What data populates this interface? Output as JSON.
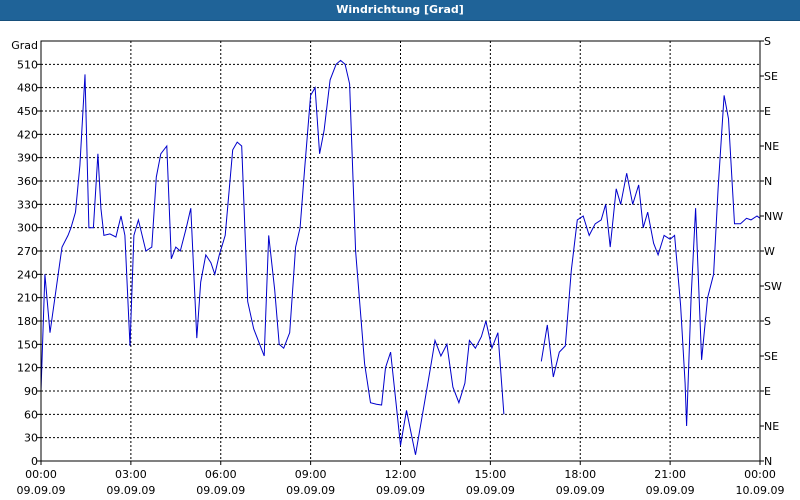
{
  "window": {
    "title": "Windrichtung [Grad]"
  },
  "chart_data": {
    "type": "line",
    "title": "Windrichtung [Grad]",
    "ylabel": "Grad",
    "xlabel": "",
    "ylim": [
      0,
      540
    ],
    "yticks": [
      0,
      30,
      60,
      90,
      120,
      150,
      180,
      210,
      240,
      270,
      300,
      330,
      360,
      390,
      420,
      450,
      480,
      510
    ],
    "right_axis": {
      "labels": [
        "N",
        "NE",
        "E",
        "SE",
        "S",
        "SW",
        "W",
        "NW",
        "N",
        "NE",
        "E",
        "SE",
        "S"
      ]
    },
    "xlim_hours": [
      0,
      24
    ],
    "xticks": [
      {
        "time": "00:00",
        "date": "09.09.09"
      },
      {
        "time": "03:00",
        "date": "09.09.09"
      },
      {
        "time": "06:00",
        "date": "09.09.09"
      },
      {
        "time": "09:00",
        "date": "09.09.09"
      },
      {
        "time": "12:00",
        "date": "09.09.09"
      },
      {
        "time": "15:00",
        "date": "09.09.09"
      },
      {
        "time": "18:00",
        "date": "09.09.09"
      },
      {
        "time": "21:00",
        "date": "09.09.09"
      },
      {
        "time": "00:00",
        "date": "10.09.09"
      }
    ],
    "grid": true,
    "line_color": "#0000cc",
    "series": [
      {
        "segments": [
          [
            [
              0.0,
              90
            ],
            [
              0.13,
              240
            ],
            [
              0.3,
              165
            ],
            [
              0.5,
              220
            ],
            [
              0.7,
              275
            ],
            [
              0.9,
              290
            ],
            [
              1.0,
              300
            ],
            [
              1.15,
              320
            ],
            [
              1.3,
              380
            ],
            [
              1.47,
              497
            ],
            [
              1.6,
              300
            ],
            [
              1.75,
              300
            ],
            [
              1.9,
              395
            ],
            [
              2.0,
              325
            ],
            [
              2.1,
              290
            ],
            [
              2.3,
              292
            ],
            [
              2.5,
              288
            ],
            [
              2.67,
              315
            ],
            [
              2.8,
              290
            ],
            [
              2.97,
              148
            ],
            [
              3.1,
              290
            ],
            [
              3.25,
              310
            ],
            [
              3.5,
              270
            ],
            [
              3.7,
              275
            ],
            [
              3.85,
              365
            ],
            [
              4.0,
              395
            ],
            [
              4.2,
              405
            ],
            [
              4.35,
              260
            ],
            [
              4.5,
              275
            ],
            [
              4.65,
              270
            ],
            [
              4.85,
              300
            ],
            [
              5.0,
              325
            ],
            [
              5.2,
              158
            ],
            [
              5.33,
              230
            ],
            [
              5.5,
              265
            ],
            [
              5.67,
              255
            ],
            [
              5.8,
              240
            ],
            [
              5.95,
              265
            ],
            [
              6.15,
              290
            ],
            [
              6.4,
              400
            ],
            [
              6.55,
              410
            ],
            [
              6.7,
              405
            ],
            [
              6.9,
              205
            ],
            [
              7.1,
              170
            ],
            [
              7.3,
              150
            ],
            [
              7.45,
              135
            ],
            [
              7.6,
              290
            ],
            [
              7.8,
              220
            ],
            [
              7.95,
              150
            ],
            [
              8.1,
              145
            ],
            [
              8.3,
              165
            ],
            [
              8.5,
              275
            ],
            [
              8.65,
              300
            ],
            [
              8.8,
              375
            ],
            [
              9.0,
              470
            ],
            [
              9.15,
              480
            ],
            [
              9.3,
              395
            ],
            [
              9.45,
              425
            ],
            [
              9.65,
              490
            ],
            [
              9.85,
              510
            ],
            [
              10.0,
              515
            ],
            [
              10.15,
              510
            ],
            [
              10.3,
              485
            ],
            [
              10.5,
              270
            ],
            [
              10.8,
              125
            ],
            [
              11.0,
              75
            ],
            [
              11.2,
              73
            ],
            [
              11.37,
              72
            ],
            [
              11.5,
              120
            ],
            [
              11.67,
              140
            ],
            [
              11.85,
              75
            ],
            [
              12.0,
              20
            ],
            [
              12.2,
              65
            ],
            [
              12.5,
              8
            ],
            [
              12.8,
              75
            ],
            [
              13.0,
              120
            ],
            [
              13.15,
              155
            ],
            [
              13.35,
              135
            ],
            [
              13.55,
              150
            ],
            [
              13.75,
              95
            ],
            [
              13.95,
              75
            ],
            [
              14.15,
              100
            ],
            [
              14.3,
              155
            ],
            [
              14.5,
              145
            ],
            [
              14.7,
              160
            ],
            [
              14.85,
              180
            ],
            [
              15.05,
              145
            ],
            [
              15.25,
              165
            ],
            [
              15.45,
              60
            ]
          ],
          [
            [
              16.7,
              128
            ],
            [
              16.9,
              175
            ],
            [
              17.1,
              108
            ],
            [
              17.3,
              140
            ],
            [
              17.5,
              148
            ],
            [
              17.7,
              245
            ],
            [
              17.9,
              310
            ],
            [
              18.1,
              315
            ],
            [
              18.3,
              290
            ],
            [
              18.5,
              305
            ],
            [
              18.7,
              310
            ],
            [
              18.85,
              330
            ],
            [
              19.0,
              275
            ],
            [
              19.2,
              350
            ],
            [
              19.35,
              330
            ],
            [
              19.55,
              370
            ],
            [
              19.75,
              330
            ],
            [
              19.95,
              355
            ],
            [
              20.1,
              300
            ],
            [
              20.25,
              320
            ],
            [
              20.45,
              280
            ],
            [
              20.6,
              265
            ],
            [
              20.8,
              290
            ],
            [
              21.0,
              285
            ],
            [
              21.15,
              290
            ],
            [
              21.35,
              200
            ],
            [
              21.5,
              100
            ],
            [
              21.55,
              45
            ],
            [
              21.7,
              210
            ],
            [
              21.85,
              325
            ],
            [
              22.05,
              130
            ],
            [
              22.25,
              210
            ],
            [
              22.45,
              240
            ],
            [
              22.6,
              350
            ],
            [
              22.8,
              470
            ],
            [
              22.95,
              440
            ],
            [
              23.15,
              305
            ],
            [
              23.35,
              305
            ],
            [
              23.55,
              312
            ],
            [
              23.7,
              310
            ],
            [
              23.9,
              315
            ],
            [
              24.1,
              312
            ],
            [
              24.3,
              295
            ],
            [
              24.5,
              285
            ],
            [
              24.7,
              282
            ]
          ]
        ]
      }
    ]
  }
}
